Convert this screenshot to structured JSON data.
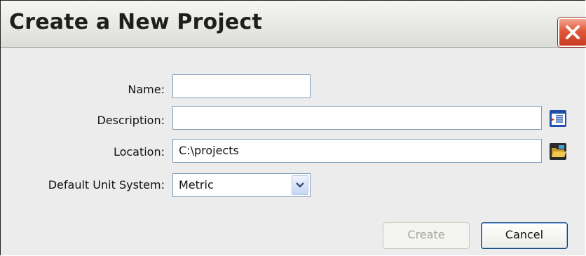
{
  "dialog": {
    "title": "Create a New Project"
  },
  "form": {
    "name": {
      "label": "Name:",
      "value": ""
    },
    "description": {
      "label": "Description:",
      "value": ""
    },
    "location": {
      "label": "Location:",
      "value": "C:\\projects"
    },
    "unit_system": {
      "label": "Default Unit System:",
      "selected": "Metric"
    }
  },
  "buttons": {
    "create": "Create",
    "cancel": "Cancel"
  },
  "icons": {
    "close": "close-icon",
    "description_browse": "text-editor-icon",
    "location_browse": "open-folder-icon",
    "dropdown": "chevron-down-icon"
  },
  "colors": {
    "close_button": "#d9492c",
    "disabled_text": "#a7a69c",
    "focus_border": "#003c74"
  }
}
